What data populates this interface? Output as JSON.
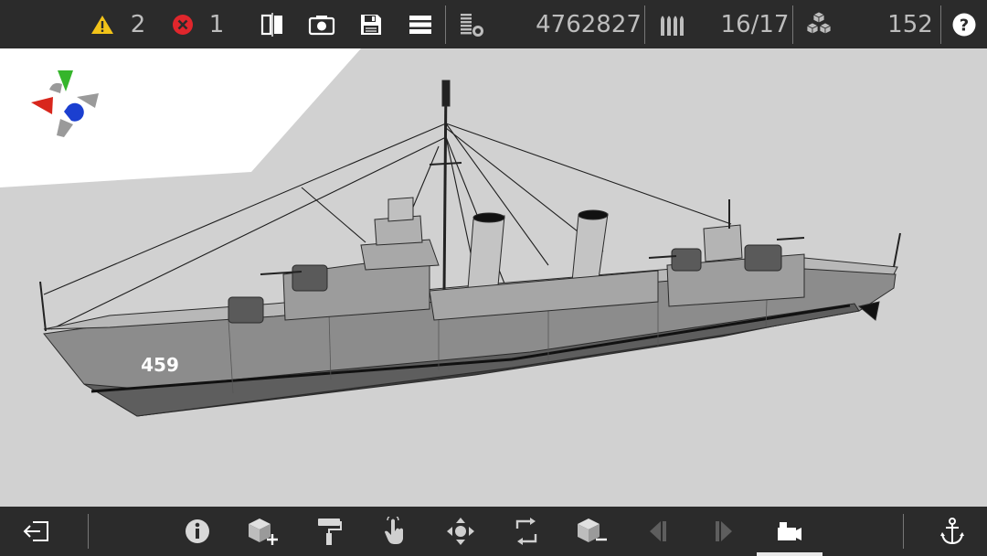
{
  "topbar": {
    "warnings_count": "2",
    "errors_count": "1",
    "polygon_count": "4762827",
    "ammo_count": "16/17",
    "parts_count": "152"
  },
  "ship": {
    "hull_number": "459"
  },
  "colors": {
    "bar_bg": "#2b2b2b",
    "viewport_bg": "#d1d1d1",
    "warning": "#f2c319",
    "error": "#e0262c",
    "gizmo_green": "#35b52b",
    "gizmo_red": "#d8261c",
    "gizmo_blue": "#1b3fd0"
  },
  "icons": {
    "top": [
      "warning-icon",
      "error-icon",
      "mirror-icon",
      "screenshot-icon",
      "save-icon",
      "menu-icon",
      "polygon-icon",
      "ammo-icon",
      "parts-icon",
      "help-icon"
    ],
    "bottom": [
      "exit-icon",
      "info-icon",
      "add-part-icon",
      "paint-icon",
      "select-icon",
      "move-icon",
      "rotate-icon",
      "remove-part-icon",
      "prev-icon",
      "next-icon",
      "camera-icon",
      "anchor-icon"
    ]
  }
}
